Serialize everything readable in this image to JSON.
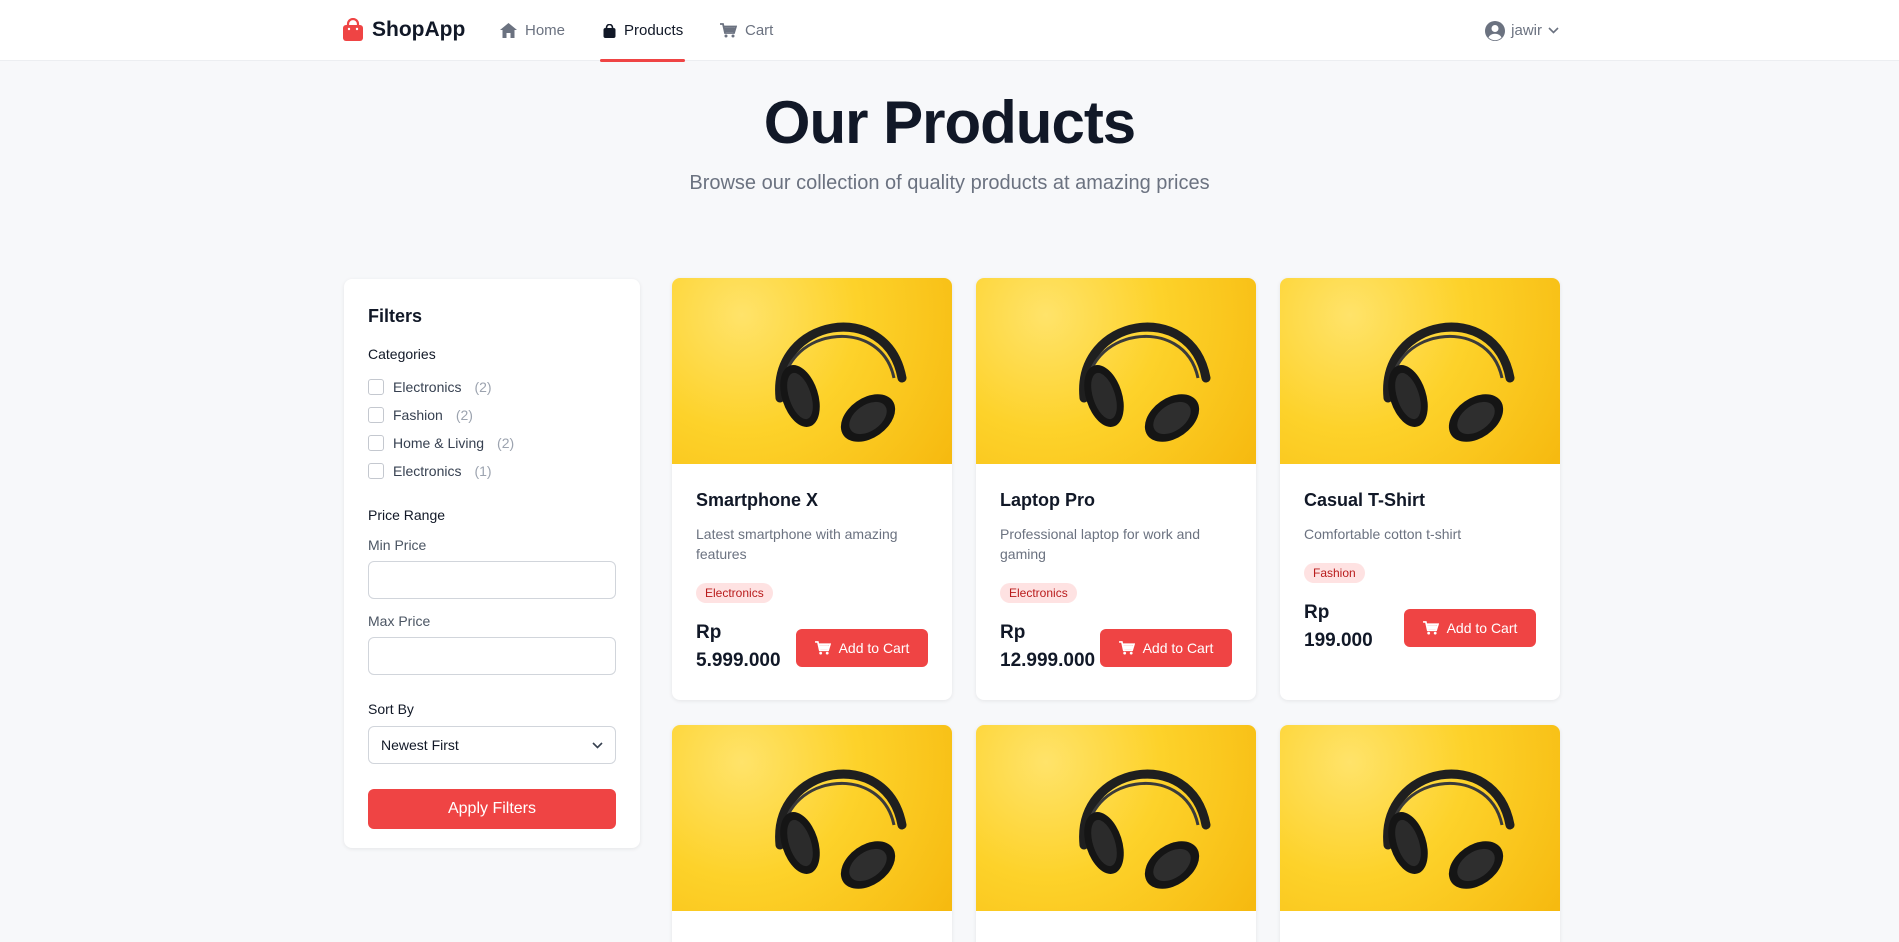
{
  "header": {
    "brand": "ShopApp",
    "nav": [
      {
        "label": "Home",
        "icon": "home-icon"
      },
      {
        "label": "Products",
        "icon": "shopping-bag-icon",
        "active": true
      },
      {
        "label": "Cart",
        "icon": "cart-icon"
      }
    ],
    "user": "jawir"
  },
  "hero": {
    "title": "Our Products",
    "subtitle": "Browse our collection of quality products at amazing prices"
  },
  "filters": {
    "title": "Filters",
    "categories_label": "Categories",
    "categories": [
      {
        "name": "Electronics",
        "count": "(2)"
      },
      {
        "name": "Fashion",
        "count": "(2)"
      },
      {
        "name": "Home & Living",
        "count": "(2)"
      },
      {
        "name": "Electronics",
        "count": "(1)"
      }
    ],
    "price_range_label": "Price Range",
    "min_price_label": "Min Price",
    "min_price_value": "",
    "max_price_label": "Max Price",
    "max_price_value": "",
    "sort_label": "Sort By",
    "sort_value": "Newest First",
    "apply_label": "Apply Filters"
  },
  "products": [
    {
      "name": "Smartphone X",
      "description": "Latest smartphone with amazing features",
      "category": "Electronics",
      "price_currency": "Rp",
      "price_value": "5.999.000",
      "add_label": "Add to Cart"
    },
    {
      "name": "Laptop Pro",
      "description": "Professional laptop for work and gaming",
      "category": "Electronics",
      "price_currency": "Rp",
      "price_value": "12.999.000",
      "add_label": "Add to Cart"
    },
    {
      "name": "Casual T-Shirt",
      "description": "Comfortable cotton t-shirt",
      "category": "Fashion",
      "price_currency": "Rp",
      "price_value": "199.000",
      "add_label": "Add to Cart"
    }
  ],
  "colors": {
    "accent": "#ef4444",
    "badge_bg": "#fee2e2",
    "badge_text": "#b91c1c",
    "image_bg": "#fdd22a"
  }
}
